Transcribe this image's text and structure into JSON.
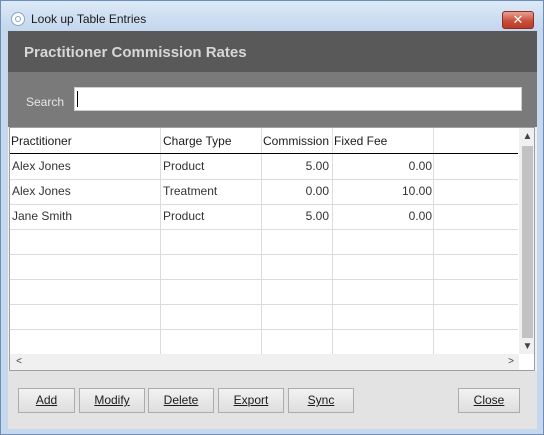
{
  "window": {
    "title": "Look up Table Entries",
    "close_label": "✕"
  },
  "header": {
    "title": "Practitioner Commission Rates"
  },
  "search": {
    "label": "Search",
    "value": ""
  },
  "table": {
    "columns": [
      "Practitioner",
      "Charge Type",
      "Commission",
      "Fixed Fee"
    ],
    "rows": [
      [
        "Alex Jones",
        "Product",
        "5.00",
        "0.00"
      ],
      [
        "Alex Jones",
        "Treatment",
        "0.00",
        "10.00"
      ],
      [
        "Jane Smith",
        "Product",
        "5.00",
        "0.00"
      ]
    ]
  },
  "scroll": {
    "up": "▲",
    "down": "▼",
    "left": "<",
    "right": ">"
  },
  "buttons": {
    "add": "Add",
    "modify": "Modify",
    "delete": "Delete",
    "export": "Export",
    "sync": "Sync",
    "close": "Close"
  }
}
